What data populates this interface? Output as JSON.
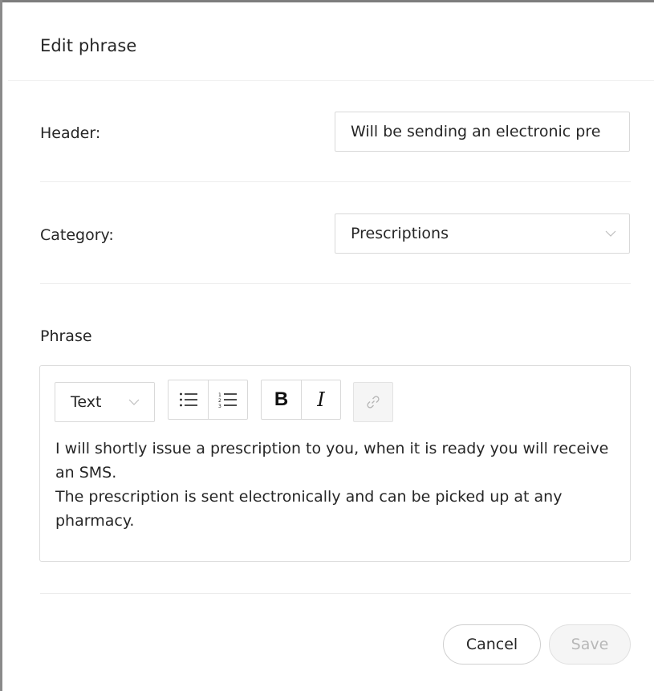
{
  "dialog": {
    "title": "Edit phrase"
  },
  "form": {
    "header_label": "Header:",
    "header_value": "Will be sending an electronic pre",
    "category_label": "Category:",
    "category_value": "Prescriptions",
    "phrase_label": "Phrase"
  },
  "editor": {
    "format_select_value": "Text",
    "toolbar": {
      "bold_label": "B",
      "italic_label": "I",
      "icons": [
        "bullet-list-icon",
        "numbered-list-icon",
        "link-icon"
      ]
    },
    "content": {
      "line1": "I will shortly issue a prescription to you, when it is ready you will receive an SMS.",
      "line2": "The prescription is sent electronically and can be picked up at any pharmacy."
    }
  },
  "footer": {
    "cancel_label": "Cancel",
    "save_label": "Save"
  },
  "colors": {
    "border": "#d9d9d9",
    "text": "#262626",
    "disabled_text": "#b8b8b8"
  }
}
